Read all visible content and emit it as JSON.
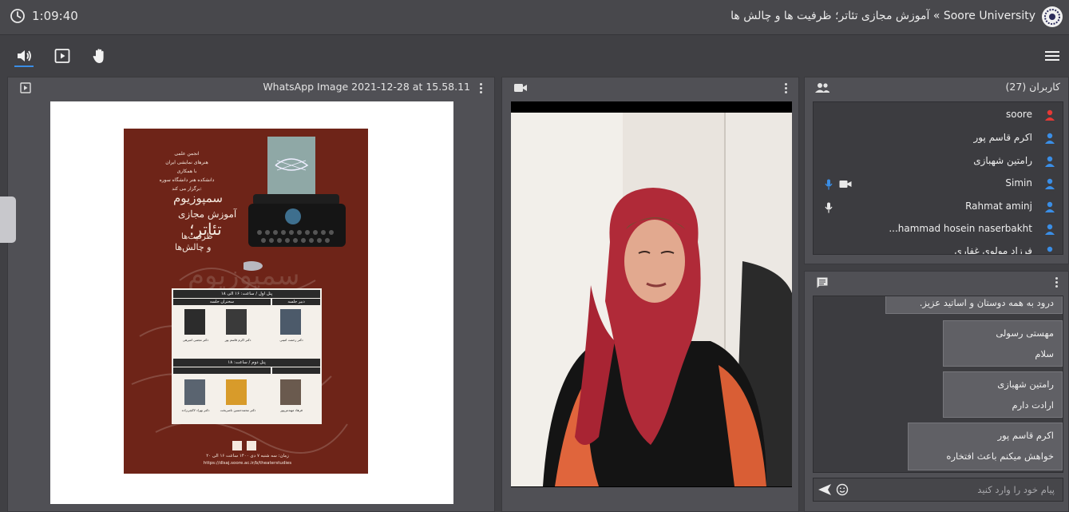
{
  "header": {
    "timer": "1:09:40",
    "title": "Soore University » آموزش مجازی تئاتر؛ ظرفیت ها و چالش ها"
  },
  "toolbar": {
    "icons": [
      "speaker-icon",
      "screen-share-icon",
      "raise-hand-icon",
      "menu-icon"
    ]
  },
  "presentation": {
    "title": "WhatsApp Image 2021-12-28 at 15.58.11",
    "poster": {
      "org_lines": [
        "انجمن علمی",
        "هنرهای نمایشی ایران",
        "با همکاری",
        "دانشکده هنر دانشگاه سوره",
        "برگزار می کند:"
      ],
      "headline_1": "سمپوزیوم",
      "headline_2": "آموزش مجازی",
      "headline_3": "تئاتر؛",
      "headline_4": "ظرفیت‌ها",
      "headline_5": "و چالش‌ها",
      "session_1": "پنل اول / ساعت: ۱۶ الی ۱۸",
      "session_2": "پنل دوم / ساعت: ۱۸",
      "col_chair": "دبیر جلسه",
      "col_speakers": "سخنران جلسه",
      "speakers_1": [
        "دکتر رحمت امینی",
        "دکتر اکرم قاسم پور",
        "دکتر مجتبی امیرهی"
      ],
      "speakers_2": [
        "فرهاد مهندس‌پور",
        "دکتر محمدحسین ناصربخت",
        "دکتر بهراد لاکچی‌زاده"
      ],
      "footer_1": "زمان: سه شنبه ۷ دی ۱۴۰۰ ساعت ۱۶ الی ۲۰",
      "footer_2": "https://dlsaj.soore.ac.ir/b/theaterstudies"
    }
  },
  "users": {
    "header": "کاربران (27)",
    "items": [
      {
        "name": "soore",
        "color": "#e53935"
      },
      {
        "name": "اکرم قاسم پور",
        "color": "#3a8ee6"
      },
      {
        "name": "رامتین شهبازی",
        "color": "#3a8ee6"
      },
      {
        "name": "Simin",
        "color": "#3a8ee6"
      },
      {
        "name": "Rahmat aminj",
        "color": "#3a8ee6"
      },
      {
        "name": "...hammad hosein naserbakht",
        "color": "#3a8ee6"
      },
      {
        "name": "فرزاد مولوی غفاری",
        "color": "#3a8ee6"
      }
    ]
  },
  "chat": {
    "messages": [
      {
        "sender": "",
        "body": "درود به همه دوستان و اساتید عزیز."
      },
      {
        "sender": "مهستی رسولی",
        "body": "سلام"
      },
      {
        "sender": "رامتین شهبازی",
        "body": "ارادت دارم"
      },
      {
        "sender": "اکرم قاسم پور",
        "body": "خواهش میکنم   باعث افتخاره"
      }
    ],
    "input_placeholder": "پیام خود را وارد کنید"
  }
}
